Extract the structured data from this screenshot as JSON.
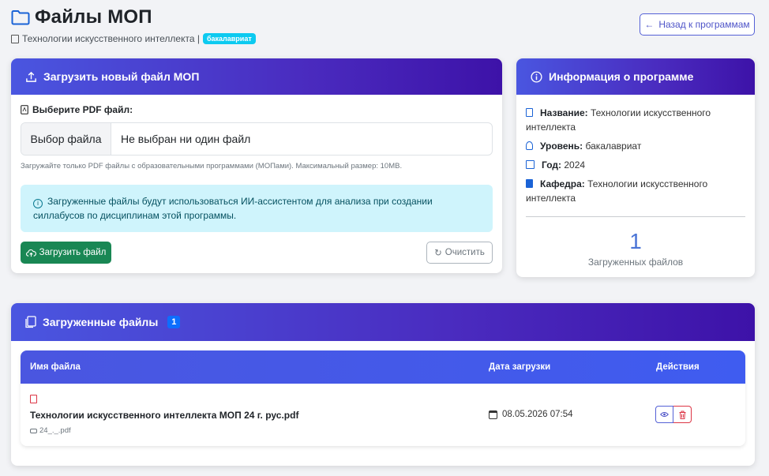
{
  "header": {
    "title": "Файлы МОП",
    "program_name": "Технологии искусственного интеллекта |",
    "level_badge": "бакалавриат",
    "back_button": "Назад к программам"
  },
  "upload": {
    "card_title": "Загрузить новый файл МОП",
    "field_label": "Выберите PDF файл:",
    "choose_button": "Выбор файла",
    "no_file_text": "Не выбран ни один файл",
    "hint": "Загружайте только PDF файлы с образовательными программами (МОПами). Максимальный размер: 10MB.",
    "alert": "Загруженные файлы будут использоваться ИИ-ассистентом для анализа при создании силлабусов по дисциплинам этой программы.",
    "upload_button": "Загрузить файл",
    "clear_button": "Очистить"
  },
  "info": {
    "card_title": "Информация о программе",
    "items": [
      {
        "label": "Название:",
        "value": "Технологии искусственного интеллекта"
      },
      {
        "label": "Уровень:",
        "value": "бакалавриат"
      },
      {
        "label": "Год:",
        "value": "2024"
      },
      {
        "label": "Кафедра:",
        "value": "Технологии искусственного интеллекта"
      }
    ],
    "files_count": "1",
    "files_count_label": "Загруженных файлов"
  },
  "files": {
    "card_title": "Загруженные файлы",
    "count_badge": "1",
    "columns": [
      "Имя файла",
      "Дата загрузки",
      "Действия"
    ],
    "rows": [
      {
        "name": "Технологии искусственного интеллекта МОП 24 г. рус.pdf",
        "stored_name": "24_._.pdf",
        "date": "08.05.2026 07:54"
      }
    ]
  },
  "colors": {
    "header_gradient_start": "#4a56e0",
    "header_gradient_end": "#3d12a8",
    "success": "#198754",
    "info_alert_bg": "#cff4fc",
    "danger": "#dc3545"
  },
  "icons": [
    "folder-icon",
    "upload-icon",
    "info-icon",
    "file-pdf-icon",
    "arrow-left-icon",
    "cloud-upload-icon",
    "refresh-icon",
    "eye-icon",
    "trash-icon",
    "calendar-icon",
    "hdd-icon"
  ]
}
